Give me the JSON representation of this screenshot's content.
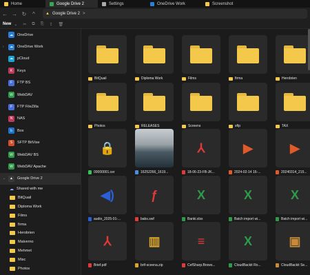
{
  "tabs": [
    {
      "label": "Home",
      "icon": "home-icon",
      "active": false
    },
    {
      "label": "Google Drive 2",
      "icon": "google-drive-icon",
      "active": true
    },
    {
      "label": "Settings",
      "icon": "gear-icon",
      "active": false
    },
    {
      "label": "OneDrive Work",
      "icon": "onedrive-icon",
      "active": false
    },
    {
      "label": "Screenshot",
      "icon": "folder-icon",
      "active": false
    }
  ],
  "address": {
    "path": "Google Drive 2",
    "sep": ">"
  },
  "toolbar": {
    "new_label": "New"
  },
  "sidebar": {
    "items": [
      {
        "label": "OneDrive",
        "icon": "onedrive-icon",
        "color": "#2b7fd8",
        "glyph": "☁"
      },
      {
        "label": "OneDrive Work",
        "icon": "onedrive-icon",
        "color": "#2b7fd8",
        "glyph": "☁",
        "chev": "›"
      },
      {
        "label": "pCloud",
        "icon": "pcloud-icon",
        "color": "#1aa3d8",
        "glyph": "☁"
      },
      {
        "label": "Keys",
        "icon": "keys-icon",
        "color": "#c0395b",
        "glyph": "K"
      },
      {
        "label": "FTP BS",
        "icon": "ftp-icon",
        "color": "#4a6fd8",
        "glyph": "F"
      },
      {
        "label": "WebDAV",
        "icon": "webdav-icon",
        "color": "#2e9a4a",
        "glyph": "W"
      },
      {
        "label": "FTP FileZilla",
        "icon": "ftp-icon",
        "color": "#4a6fd8",
        "glyph": "F"
      },
      {
        "label": "NAS",
        "icon": "nas-icon",
        "color": "#c0395b",
        "glyph": "N"
      },
      {
        "label": "Box",
        "icon": "box-icon",
        "color": "#1f74d0",
        "glyph": "b"
      },
      {
        "label": "SFTP BitVise",
        "icon": "sftp-icon",
        "color": "#d0502b",
        "glyph": "S"
      },
      {
        "label": "WebDAV BS",
        "icon": "webdav-icon",
        "color": "#2e9a4a",
        "glyph": "W"
      },
      {
        "label": "WebDAV Apache",
        "icon": "webdav-icon",
        "color": "#2e9a4a",
        "glyph": "W"
      },
      {
        "label": "Google Drive 2",
        "icon": "google-drive-icon",
        "color": "#3a3a3a",
        "glyph": "▲",
        "chev": "⌄",
        "active": true
      }
    ],
    "children": [
      {
        "label": "Shared with me",
        "icon": "shared-icon"
      },
      {
        "label": "BitQuail",
        "icon": "folder-icon"
      },
      {
        "label": "Diploma Work",
        "icon": "folder-icon"
      },
      {
        "label": "Films",
        "icon": "folder-icon"
      },
      {
        "label": "firma",
        "icon": "folder-icon"
      },
      {
        "label": "Herobrien",
        "icon": "folder-icon"
      },
      {
        "label": "Malverno",
        "icon": "folder-icon"
      },
      {
        "label": "Mehmet",
        "icon": "folder-icon"
      },
      {
        "label": "Misc",
        "icon": "folder-icon"
      },
      {
        "label": "Photos",
        "icon": "folder-icon"
      }
    ]
  },
  "grid": [
    {
      "label": "BitQuail",
      "kind": "folder"
    },
    {
      "label": "Diploma Work",
      "kind": "folder"
    },
    {
      "label": "Films",
      "kind": "folder"
    },
    {
      "label": "firma",
      "kind": "folder"
    },
    {
      "label": "Herobrien",
      "kind": "folder"
    },
    {
      "label": "Photos",
      "kind": "folder"
    },
    {
      "label": "RELEASES",
      "kind": "folder"
    },
    {
      "label": "Screens",
      "kind": "folder"
    },
    {
      "label": "sftp",
      "kind": "folder"
    },
    {
      "label": "TAX",
      "kind": "folder"
    },
    {
      "label": "00000001.cer",
      "kind": "file",
      "icon": "lock-icon",
      "glyph": "🔒",
      "color": "#3bbf5a"
    },
    {
      "label": "16252266_1619...",
      "kind": "image",
      "icon": "image-icon"
    },
    {
      "label": "18-06-23-FB-JK...",
      "kind": "file",
      "icon": "pdf-icon",
      "glyph": "⅄",
      "color": "#e03a3a"
    },
    {
      "label": "2024-02-14 16-...",
      "kind": "file",
      "icon": "video-icon",
      "glyph": "▶",
      "color": "#e05a2a"
    },
    {
      "label": "20240314_215...",
      "kind": "file",
      "icon": "video-icon",
      "glyph": "▶",
      "color": "#e05a2a"
    },
    {
      "label": "audio_2025-01-...",
      "kind": "file",
      "icon": "audio-icon",
      "glyph": "◀)",
      "color": "#2b5fd8"
    },
    {
      "label": "babs.swf",
      "kind": "file",
      "icon": "flash-icon",
      "glyph": "ƒ",
      "color": "#e03a3a"
    },
    {
      "label": "Banki.xlsx",
      "kind": "file",
      "icon": "excel-icon",
      "glyph": "X",
      "color": "#2e9a4a"
    },
    {
      "label": "Batch import wi...",
      "kind": "file",
      "icon": "excel-icon",
      "glyph": "X",
      "color": "#2e9a4a"
    },
    {
      "label": "Batch import wi...",
      "kind": "file",
      "icon": "excel-icon",
      "glyph": "X",
      "color": "#2e9a4a"
    },
    {
      "label": "Brief.pdf",
      "kind": "file",
      "icon": "pdf-icon",
      "glyph": "⅄",
      "color": "#e03a3a"
    },
    {
      "label": "brif-sceena.zip",
      "kind": "file",
      "icon": "zip-icon",
      "glyph": "▥",
      "color": "#d9a52b"
    },
    {
      "label": "CefSharp.Brows...",
      "kind": "file",
      "icon": "database-icon",
      "glyph": "≡",
      "color": "#e03a3a"
    },
    {
      "label": "CloudBackit Ro...",
      "kind": "file",
      "icon": "excel-icon",
      "glyph": "X",
      "color": "#2e9a4a"
    },
    {
      "label": "CloudBackit Se...",
      "kind": "file",
      "icon": "package-icon",
      "glyph": "▣",
      "color": "#c98a3a"
    }
  ]
}
